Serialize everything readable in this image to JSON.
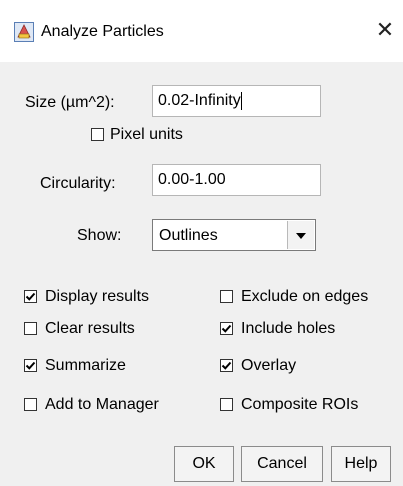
{
  "window": {
    "title": "Analyze Particles",
    "icon": "imagej-icon",
    "close_glyph": "✕"
  },
  "fields": {
    "size_label": "Size (µm^2):",
    "size_value": "0.02-Infinity",
    "pixel_units_label": "Pixel units",
    "pixel_units_checked": false,
    "circularity_label": "Circularity:",
    "circularity_value": "0.00-1.00",
    "show_label": "Show:",
    "show_value": "Outlines"
  },
  "checkboxes": {
    "display_results": {
      "label": "Display results",
      "checked": true
    },
    "exclude_on_edges": {
      "label": "Exclude on edges",
      "checked": false
    },
    "clear_results": {
      "label": "Clear results",
      "checked": false
    },
    "include_holes": {
      "label": "Include holes",
      "checked": true
    },
    "summarize": {
      "label": "Summarize",
      "checked": true
    },
    "overlay": {
      "label": "Overlay",
      "checked": true
    },
    "add_to_manager": {
      "label": "Add to Manager",
      "checked": false
    },
    "composite_rois": {
      "label": "Composite ROIs",
      "checked": false
    }
  },
  "buttons": {
    "ok": "OK",
    "cancel": "Cancel",
    "help": "Help"
  },
  "colors": {
    "dialog_bg": "#f0f0f0",
    "titlebar_bg": "#ffffff"
  }
}
